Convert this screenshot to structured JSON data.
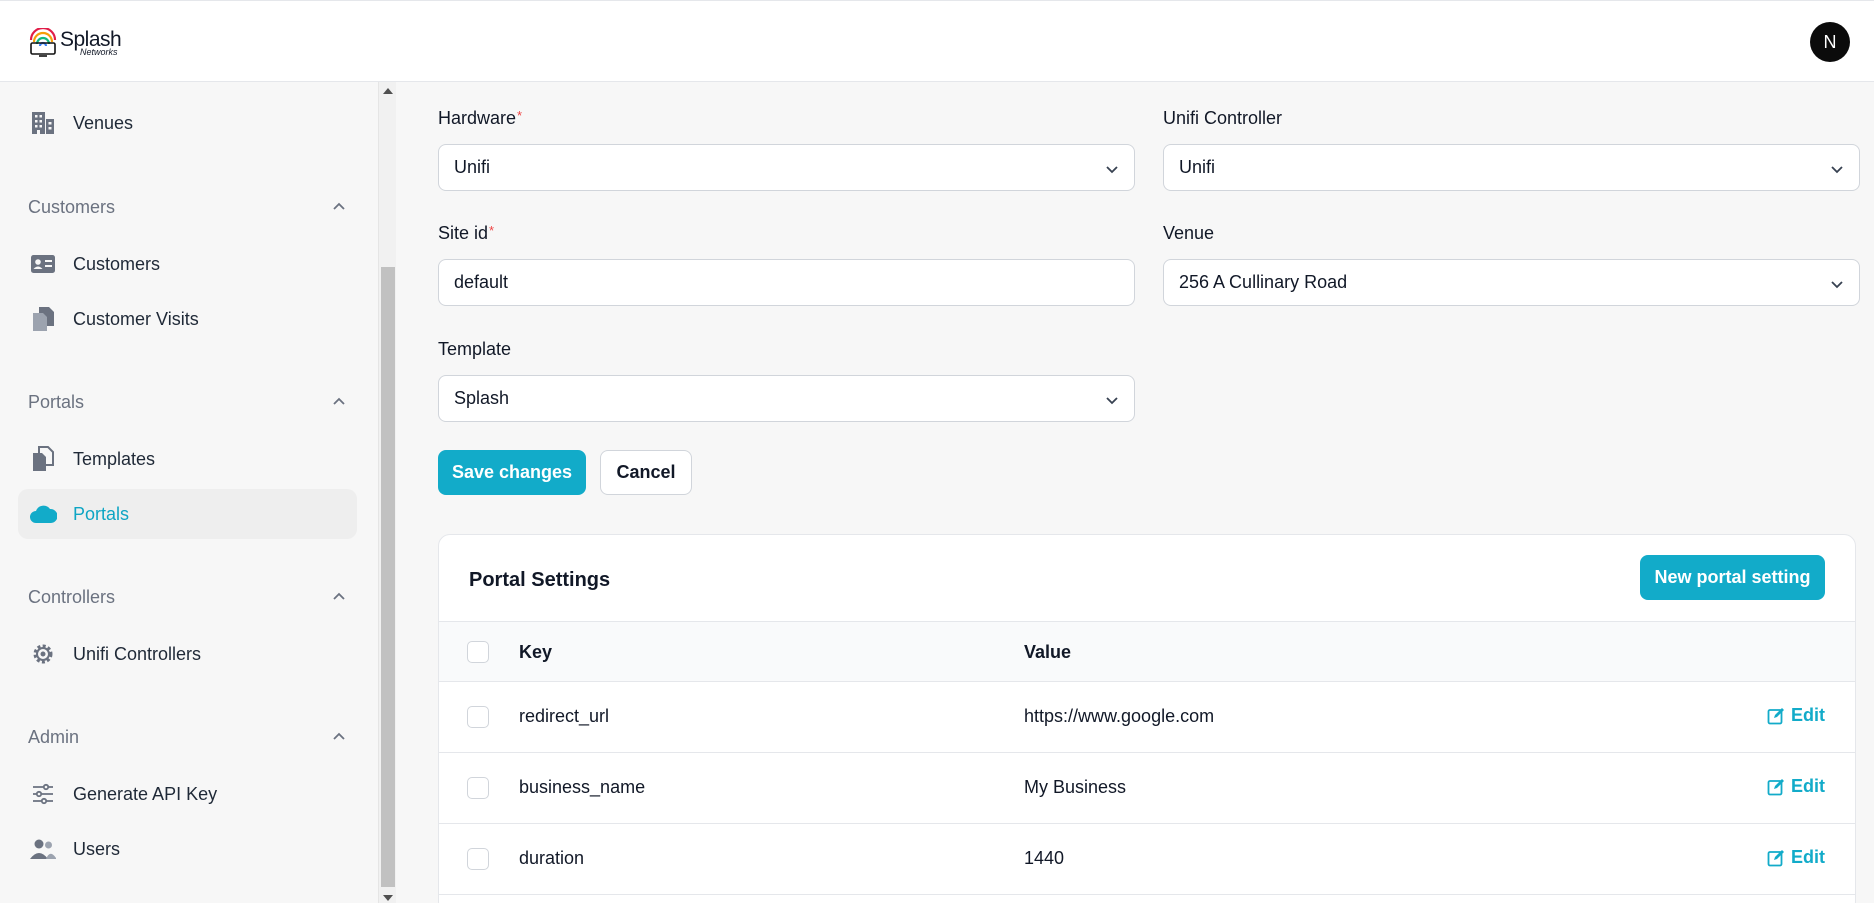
{
  "header": {
    "logo_line1": "Splash",
    "logo_line2": "Networks",
    "avatar_initial": "N"
  },
  "sidebar": {
    "items": [
      {
        "label": "Venues",
        "icon": "building-icon"
      },
      {
        "group": "Customers"
      },
      {
        "label": "Customers",
        "icon": "id-card-icon"
      },
      {
        "label": "Customer Visits",
        "icon": "documents-icon"
      },
      {
        "group": "Portals"
      },
      {
        "label": "Templates",
        "icon": "copy-icon"
      },
      {
        "label": "Portals",
        "icon": "cloud-icon",
        "active": true
      },
      {
        "group": "Controllers"
      },
      {
        "label": "Unifi Controllers",
        "icon": "gear-icon"
      },
      {
        "group": "Admin"
      },
      {
        "label": "Generate API Key",
        "icon": "sliders-icon"
      },
      {
        "label": "Users",
        "icon": "users-icon"
      }
    ]
  },
  "form": {
    "hardware_label": "Hardware",
    "hardware_value": "Unifi",
    "controller_label": "Unifi Controller",
    "controller_value": "Unifi",
    "site_label": "Site id",
    "site_value": "default",
    "venue_label": "Venue",
    "venue_value": "256 A Cullinary Road",
    "template_label": "Template",
    "template_value": "Splash",
    "required_mark": "*",
    "save_label": "Save changes",
    "cancel_label": "Cancel"
  },
  "settings": {
    "title": "Portal Settings",
    "new_label": "New portal setting",
    "col_key": "Key",
    "col_value": "Value",
    "edit_label": "Edit",
    "rows": [
      {
        "key": "redirect_url",
        "value": "https://www.google.com"
      },
      {
        "key": "business_name",
        "value": "My Business"
      },
      {
        "key": "duration",
        "value": "1440"
      }
    ]
  },
  "colors": {
    "accent": "#12abc9",
    "required": "#ef4444"
  }
}
